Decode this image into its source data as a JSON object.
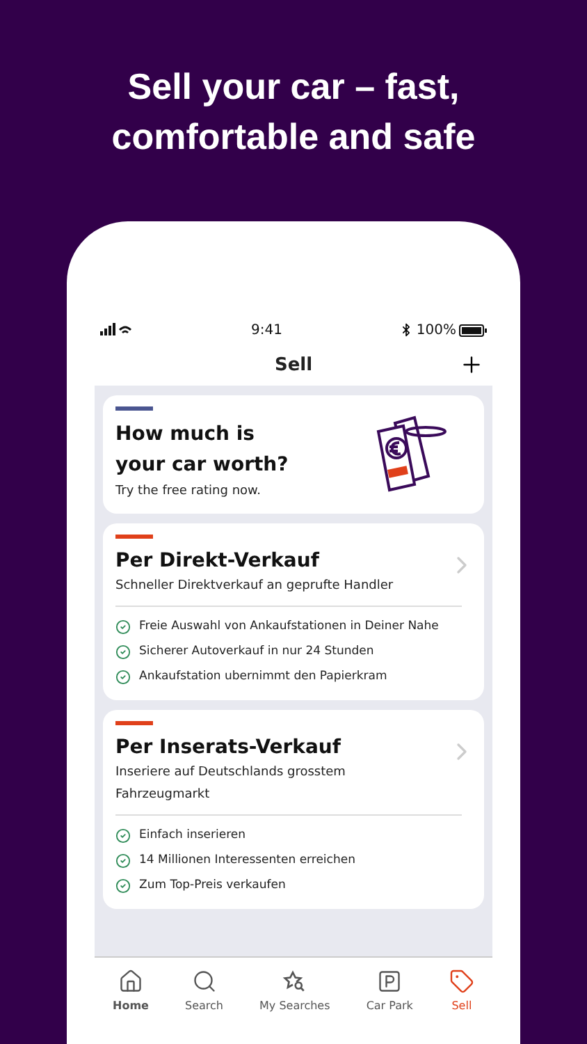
{
  "headline": "Sell your car – fast, comfortable and safe",
  "status_bar": {
    "time": "9:41",
    "battery": "100%"
  },
  "nav": {
    "title": "Sell"
  },
  "promo": {
    "title": "How much is your car worth?",
    "subtitle": "Try the free rating now."
  },
  "options": [
    {
      "title": "Per Direkt-Verkauf",
      "subtitle": "Schneller Direktverkauf an geprufte Handler",
      "features": [
        "Freie Auswahl von Ankaufstationen in Deiner Nahe",
        "Sicherer Autoverkauf in nur 24 Stunden",
        "Ankaufstation ubernimmt den Papierkram"
      ]
    },
    {
      "title": "Per Inserats-Verkauf",
      "subtitle": "Inseriere auf Deutschlands grosstem Fahrzeugmarkt",
      "features": [
        "Einfach inserieren",
        "14 Millionen Interessenten erreichen",
        "Zum Top-Preis verkaufen"
      ]
    }
  ],
  "tabs": [
    {
      "label": "Home",
      "kind": "home",
      "bold": true,
      "selected": false
    },
    {
      "label": "Search",
      "kind": "search",
      "bold": false,
      "selected": false
    },
    {
      "label": "My Searches",
      "kind": "saved",
      "bold": false,
      "selected": false
    },
    {
      "label": "Car Park",
      "kind": "park",
      "bold": false,
      "selected": false
    },
    {
      "label": "Sell",
      "kind": "sell",
      "bold": false,
      "selected": true
    }
  ]
}
